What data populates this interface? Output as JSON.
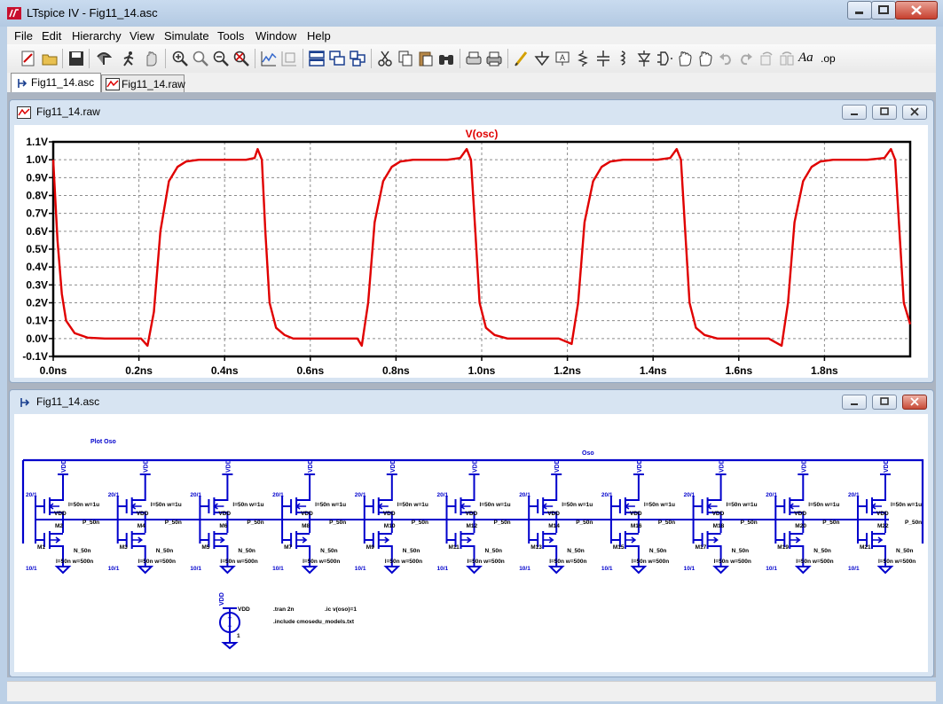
{
  "window": {
    "title": "LTspice IV - Fig11_14.asc"
  },
  "menu": [
    "File",
    "Edit",
    "Hierarchy",
    "View",
    "Simulate",
    "Tools",
    "Window",
    "Help"
  ],
  "toolbar": {
    "icons": [
      "new-schematic-icon",
      "open-icon",
      "save-icon",
      "control-panel-icon",
      "run-icon",
      "halt-icon",
      "zoom-in-icon",
      "zoom-pan-icon",
      "zoom-out-icon",
      "zoom-fit-icon",
      "autorange-icon",
      "delete-trace-icon",
      "tile-horizontal-icon",
      "cascade-icon",
      "tile-icon",
      "cut-icon",
      "copy-icon",
      "paste-icon",
      "find-icon",
      "print-setup-icon",
      "print-icon",
      "wire-icon",
      "ground-icon",
      "label-net-icon",
      "resistor-icon",
      "capacitor-icon",
      "inductor-icon",
      "diode-icon",
      "component-icon",
      "move-icon",
      "drag-icon",
      "undo-icon",
      "redo-icon",
      "rotate-icon",
      "mirror-icon",
      "text-icon",
      "spice-directive-icon"
    ],
    "text_labels": {
      "text": "Aa",
      "directive": ".op"
    }
  },
  "tabs": [
    {
      "label": "Fig11_14.asc",
      "active": true
    },
    {
      "label": "Fig11_14.raw",
      "active": false
    }
  ],
  "plot_window": {
    "title": "Fig11_14.raw"
  },
  "schematic_window": {
    "title": "Fig11_14.asc",
    "labels": {
      "plot_label": "Plot Oso",
      "net_label": "Oso",
      "vdd": "VDD",
      "pmos_size": "l=50n w=1u",
      "pmos_model": "P_50n",
      "nmos_model": "N_50n",
      "nmos_size": "l=50n w=500n",
      "p_ratio": "20/1",
      "n_ratio": "10/1",
      "source_name": "VDD",
      "source_value": "1",
      "directive_tran": ".tran 2n",
      "directive_ic": ".ic v(oso)=1",
      "directive_include": ".include cmosedu_models.txt"
    },
    "stages": [
      {
        "p": "M2",
        "n": "M1"
      },
      {
        "p": "M4",
        "n": "M3"
      },
      {
        "p": "M6",
        "n": "M5"
      },
      {
        "p": "M8",
        "n": "M7"
      },
      {
        "p": "M10",
        "n": "M9"
      },
      {
        "p": "M12",
        "n": "M11"
      },
      {
        "p": "M14",
        "n": "M13"
      },
      {
        "p": "M16",
        "n": "M15"
      },
      {
        "p": "M18",
        "n": "M17"
      },
      {
        "p": "M20",
        "n": "M19"
      },
      {
        "p": "M22",
        "n": "M21"
      }
    ]
  },
  "colors": {
    "trace": "#e00000",
    "schematic": "#0000cc",
    "grid": "#8c8c8c"
  },
  "chart_data": {
    "type": "line",
    "title": "V(osc)",
    "xlim": [
      0,
      2.0
    ],
    "ylim": [
      -0.1,
      1.1
    ],
    "x_ticks": [
      "0.0ns",
      "0.2ns",
      "0.4ns",
      "0.6ns",
      "0.8ns",
      "1.0ns",
      "1.2ns",
      "1.4ns",
      "1.6ns",
      "1.8ns"
    ],
    "y_ticks": [
      "1.1V",
      "1.0V",
      "0.9V",
      "0.8V",
      "0.7V",
      "0.6V",
      "0.5V",
      "0.4V",
      "0.3V",
      "0.2V",
      "0.1V",
      "0.0V",
      "-0.1V"
    ],
    "grid": true,
    "series": [
      {
        "name": "V(osc)",
        "x": [
          0.0,
          0.01,
          0.02,
          0.03,
          0.05,
          0.08,
          0.12,
          0.16,
          0.19,
          0.205,
          0.22,
          0.235,
          0.25,
          0.27,
          0.29,
          0.31,
          0.34,
          0.38,
          0.42,
          0.45,
          0.47,
          0.477,
          0.487,
          0.495,
          0.505,
          0.52,
          0.54,
          0.56,
          0.6,
          0.64,
          0.68,
          0.71,
          0.72,
          0.735,
          0.75,
          0.77,
          0.79,
          0.81,
          0.84,
          0.88,
          0.92,
          0.95,
          0.965,
          0.975,
          0.985,
          0.995,
          1.01,
          1.03,
          1.06,
          1.1,
          1.14,
          1.18,
          1.21,
          1.225,
          1.24,
          1.26,
          1.28,
          1.3,
          1.33,
          1.37,
          1.41,
          1.44,
          1.455,
          1.465,
          1.475,
          1.485,
          1.5,
          1.52,
          1.55,
          1.59,
          1.63,
          1.67,
          1.7,
          1.715,
          1.73,
          1.75,
          1.77,
          1.79,
          1.82,
          1.86,
          1.9,
          1.94,
          1.955,
          1.965,
          1.975,
          1.985,
          2.0
        ],
        "y": [
          1.0,
          0.55,
          0.25,
          0.1,
          0.03,
          0.005,
          0.0,
          0.0,
          0.0,
          0.0,
          -0.04,
          0.15,
          0.6,
          0.88,
          0.96,
          0.99,
          1.0,
          1.0,
          1.0,
          1.0,
          1.01,
          1.06,
          1.0,
          0.6,
          0.2,
          0.06,
          0.02,
          0.0,
          0.0,
          0.0,
          0.0,
          0.0,
          -0.04,
          0.2,
          0.65,
          0.88,
          0.96,
          0.99,
          1.0,
          1.0,
          1.0,
          1.01,
          1.06,
          1.0,
          0.6,
          0.2,
          0.06,
          0.02,
          0.0,
          0.0,
          0.0,
          0.0,
          -0.03,
          0.2,
          0.65,
          0.88,
          0.96,
          0.99,
          1.0,
          1.0,
          1.0,
          1.01,
          1.06,
          1.0,
          0.6,
          0.2,
          0.06,
          0.02,
          0.0,
          0.0,
          0.0,
          0.0,
          -0.04,
          0.2,
          0.65,
          0.88,
          0.96,
          0.99,
          1.0,
          1.0,
          1.0,
          1.01,
          1.06,
          1.0,
          0.6,
          0.2,
          0.08
        ]
      }
    ]
  }
}
